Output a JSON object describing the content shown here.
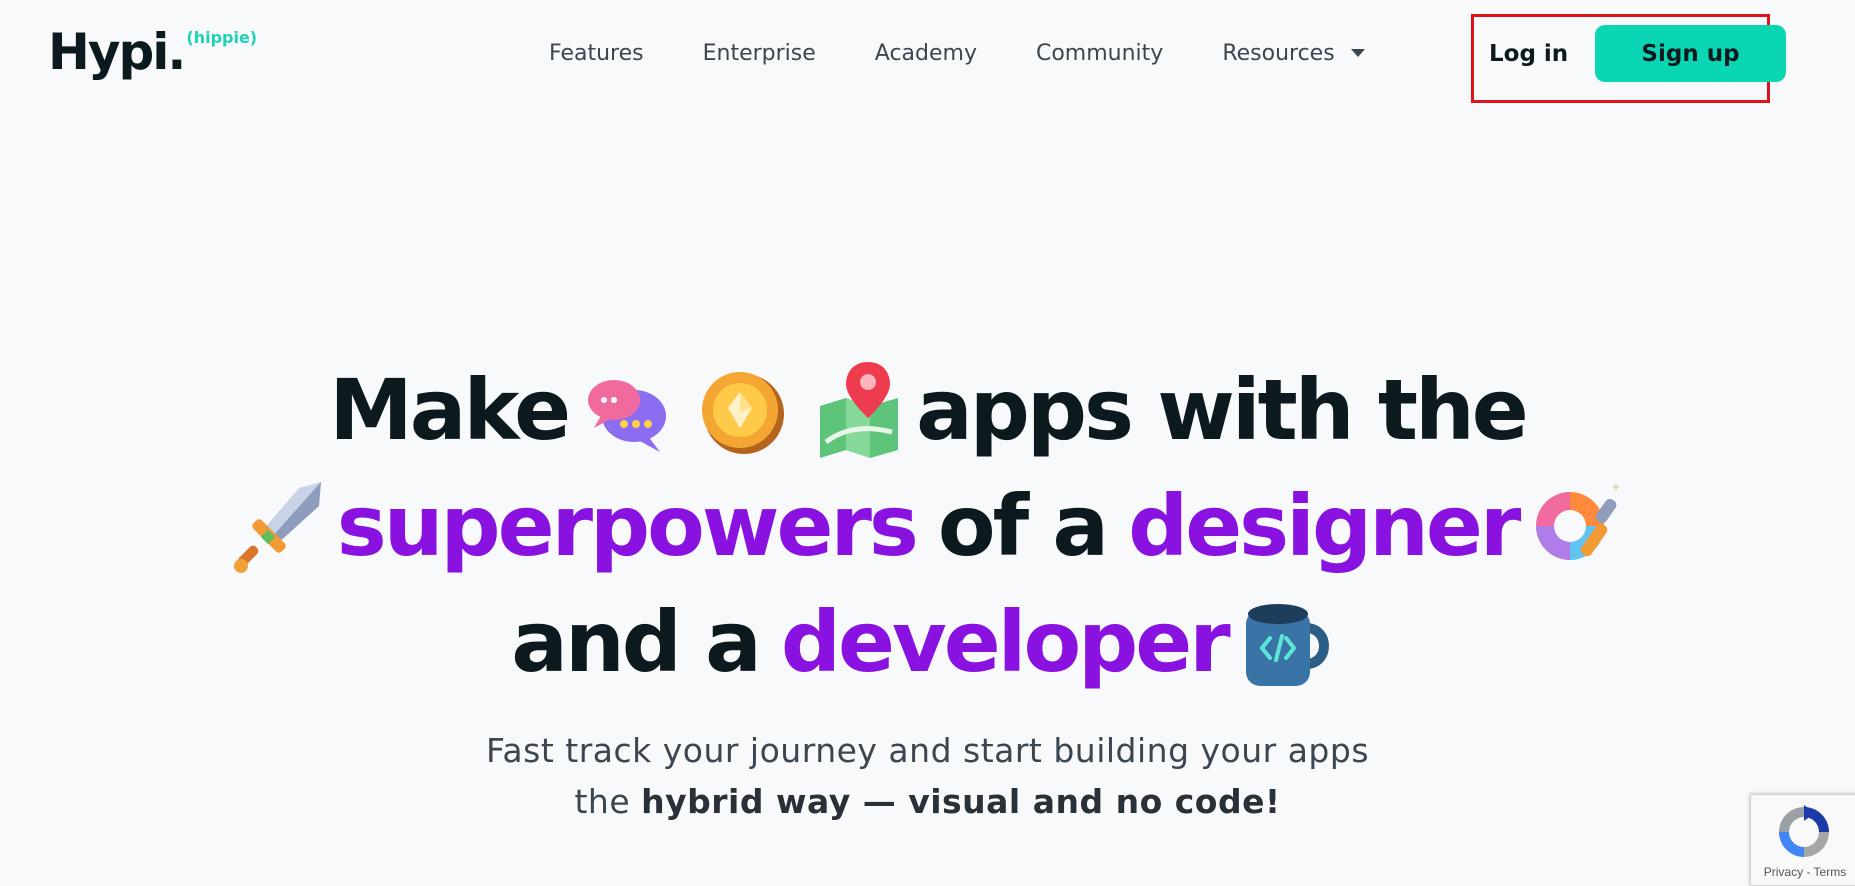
{
  "header": {
    "logo_text": "Hypi.",
    "logo_sup": "(hippie)",
    "nav": [
      {
        "label": "Features"
      },
      {
        "label": "Enterprise"
      },
      {
        "label": "Academy"
      },
      {
        "label": "Community"
      },
      {
        "label": "Resources",
        "has_dropdown": true
      }
    ],
    "login_label": "Log in",
    "signup_label": "Sign up"
  },
  "hero": {
    "line1_a": "Make",
    "line1_b": "apps with the",
    "line2_a": "superpowers",
    "line2_b": "of a",
    "line2_c": "designer",
    "line3_a": "and a",
    "line3_b": "developer",
    "emojis": [
      "chat-bubbles-icon",
      "coin-icon",
      "map-pin-icon",
      "sword-icon",
      "color-wheel-icon",
      "code-mug-icon"
    ],
    "subtitle_line1": "Fast track your journey and start building your apps",
    "subtitle_line2_pre": "the",
    "subtitle_line2_bold": "hybrid way — visual and no code!"
  },
  "recaptcha": {
    "links": "Privacy - Terms"
  },
  "colors": {
    "accent": "#0ad6b3",
    "purple": "#8a12e0",
    "highlight_border": "#e0131d"
  }
}
